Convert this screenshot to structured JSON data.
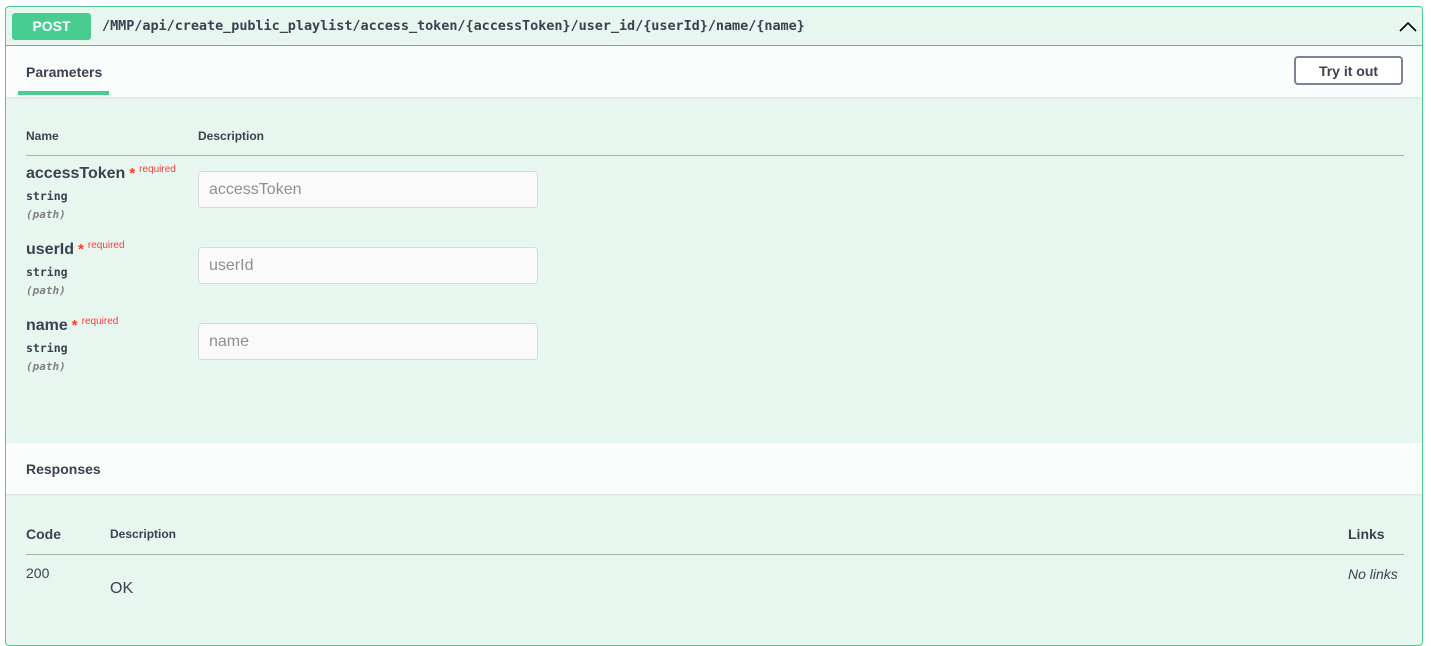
{
  "operation": {
    "method": "POST",
    "path": "/MMP/api/create_public_playlist/access_token/{accessToken}/user_id/{userId}/name/{name}",
    "colors": {
      "method_bg": "#49cc90",
      "block_bg": "#e8f6f0",
      "border": "#49cc90"
    }
  },
  "parameters": {
    "tab_label": "Parameters",
    "try_it_out_label": "Try it out",
    "col_name": "Name",
    "col_description": "Description",
    "items": [
      {
        "name": "accessToken",
        "star": "*",
        "required": "required",
        "type": "string",
        "in": "(path)",
        "placeholder": "accessToken"
      },
      {
        "name": "userId",
        "star": "*",
        "required": "required",
        "type": "string",
        "in": "(path)",
        "placeholder": "userId"
      },
      {
        "name": "name",
        "star": "*",
        "required": "required",
        "type": "string",
        "in": "(path)",
        "placeholder": "name"
      }
    ]
  },
  "responses": {
    "title": "Responses",
    "col_code": "Code",
    "col_description": "Description",
    "col_links": "Links",
    "rows": [
      {
        "code": "200",
        "description": "OK",
        "links": "No links"
      }
    ]
  },
  "icons": {
    "collapse": "chevron-up-icon"
  }
}
